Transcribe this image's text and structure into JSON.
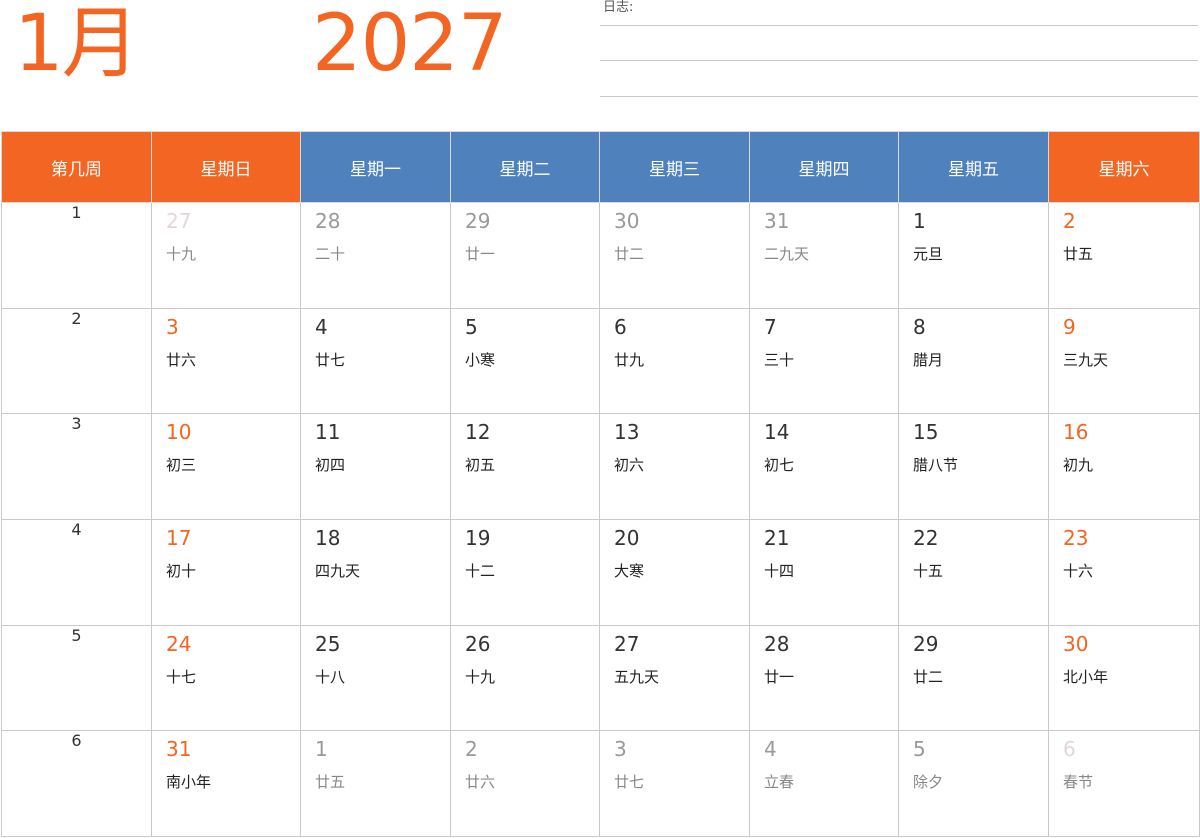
{
  "header": {
    "month": "1月",
    "year": "2027",
    "notes_label": "日志:"
  },
  "colors": {
    "accent": "#f26522",
    "weekday_header": "#4f81bd"
  },
  "columns": [
    "第几周",
    "星期日",
    "星期一",
    "星期二",
    "星期三",
    "星期四",
    "星期五",
    "星期六"
  ],
  "weeks": [
    {
      "week": "1",
      "days": [
        {
          "day": "27",
          "lunar": "十九",
          "state": "other-weekend"
        },
        {
          "day": "28",
          "lunar": "二十",
          "state": "other"
        },
        {
          "day": "29",
          "lunar": "廿一",
          "state": "other"
        },
        {
          "day": "30",
          "lunar": "廿二",
          "state": "other"
        },
        {
          "day": "31",
          "lunar": "二九天",
          "state": "other"
        },
        {
          "day": "1",
          "lunar": "元旦",
          "state": "cur"
        },
        {
          "day": "2",
          "lunar": "廿五",
          "state": "cur-weekend"
        }
      ]
    },
    {
      "week": "2",
      "days": [
        {
          "day": "3",
          "lunar": "廿六",
          "state": "cur-weekend"
        },
        {
          "day": "4",
          "lunar": "廿七",
          "state": "cur"
        },
        {
          "day": "5",
          "lunar": "小寒",
          "state": "cur"
        },
        {
          "day": "6",
          "lunar": "廿九",
          "state": "cur"
        },
        {
          "day": "7",
          "lunar": "三十",
          "state": "cur"
        },
        {
          "day": "8",
          "lunar": "腊月",
          "state": "cur"
        },
        {
          "day": "9",
          "lunar": "三九天",
          "state": "cur-weekend"
        }
      ]
    },
    {
      "week": "3",
      "days": [
        {
          "day": "10",
          "lunar": "初三",
          "state": "cur-weekend"
        },
        {
          "day": "11",
          "lunar": "初四",
          "state": "cur"
        },
        {
          "day": "12",
          "lunar": "初五",
          "state": "cur"
        },
        {
          "day": "13",
          "lunar": "初六",
          "state": "cur"
        },
        {
          "day": "14",
          "lunar": "初七",
          "state": "cur"
        },
        {
          "day": "15",
          "lunar": "腊八节",
          "state": "cur"
        },
        {
          "day": "16",
          "lunar": "初九",
          "state": "cur-weekend"
        }
      ]
    },
    {
      "week": "4",
      "days": [
        {
          "day": "17",
          "lunar": "初十",
          "state": "cur-weekend"
        },
        {
          "day": "18",
          "lunar": "四九天",
          "state": "cur"
        },
        {
          "day": "19",
          "lunar": "十二",
          "state": "cur"
        },
        {
          "day": "20",
          "lunar": "大寒",
          "state": "cur"
        },
        {
          "day": "21",
          "lunar": "十四",
          "state": "cur"
        },
        {
          "day": "22",
          "lunar": "十五",
          "state": "cur"
        },
        {
          "day": "23",
          "lunar": "十六",
          "state": "cur-weekend"
        }
      ]
    },
    {
      "week": "5",
      "days": [
        {
          "day": "24",
          "lunar": "十七",
          "state": "cur-weekend"
        },
        {
          "day": "25",
          "lunar": "十八",
          "state": "cur"
        },
        {
          "day": "26",
          "lunar": "十九",
          "state": "cur"
        },
        {
          "day": "27",
          "lunar": "五九天",
          "state": "cur"
        },
        {
          "day": "28",
          "lunar": "廿一",
          "state": "cur"
        },
        {
          "day": "29",
          "lunar": "廿二",
          "state": "cur"
        },
        {
          "day": "30",
          "lunar": "北小年",
          "state": "cur-weekend"
        }
      ]
    },
    {
      "week": "6",
      "days": [
        {
          "day": "31",
          "lunar": "南小年",
          "state": "cur-weekend"
        },
        {
          "day": "1",
          "lunar": "廿五",
          "state": "other"
        },
        {
          "day": "2",
          "lunar": "廿六",
          "state": "other"
        },
        {
          "day": "3",
          "lunar": "廿七",
          "state": "other"
        },
        {
          "day": "4",
          "lunar": "立春",
          "state": "other"
        },
        {
          "day": "5",
          "lunar": "除夕",
          "state": "other"
        },
        {
          "day": "6",
          "lunar": "春节",
          "state": "other-weekend"
        }
      ]
    }
  ]
}
